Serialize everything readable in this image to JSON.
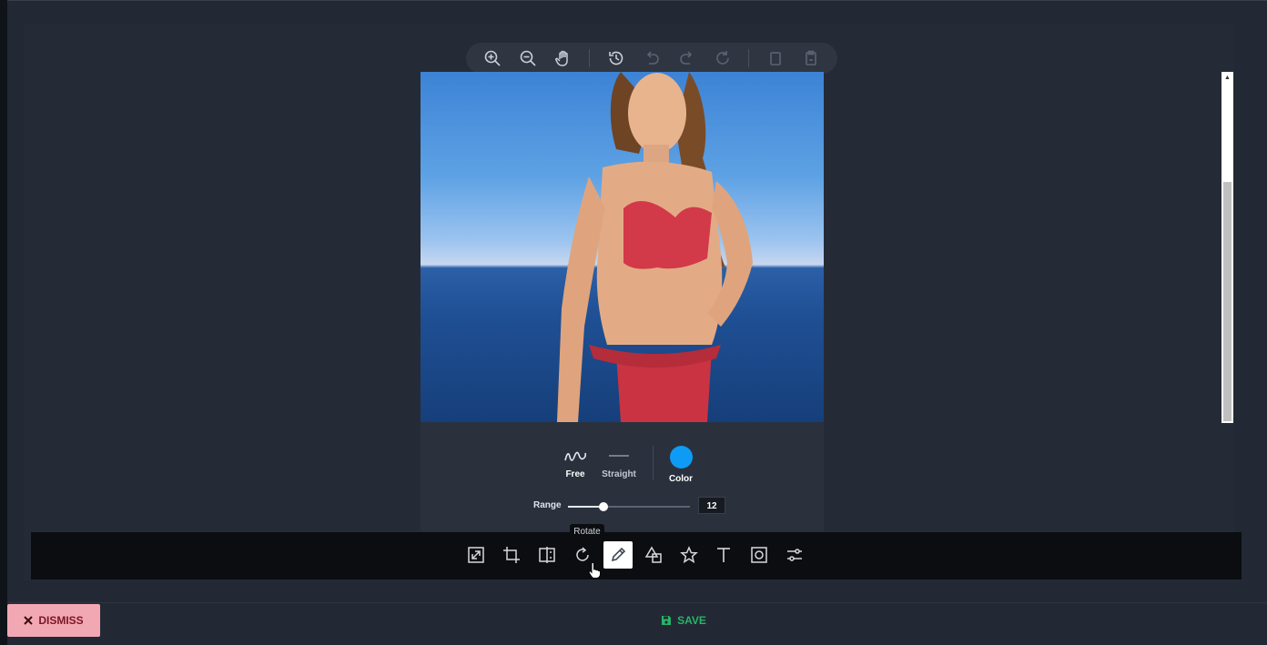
{
  "top_toolbar": {
    "icons": [
      "zoom-in-icon",
      "zoom-out-icon",
      "hand-icon",
      "history-icon",
      "undo-icon",
      "redo-icon",
      "reset-icon",
      "copy-icon",
      "paste-icon"
    ]
  },
  "draw_panel": {
    "stroke_free": "Free",
    "stroke_straight": "Straight",
    "color_label": "Color",
    "color_value": "#0d9bf5",
    "range_label": "Range",
    "range_value": "12",
    "range_fraction": 0.29
  },
  "bottom_toolbar": {
    "tools": [
      "resize",
      "crop",
      "flip",
      "rotate",
      "draw",
      "shape",
      "icon",
      "text",
      "mask",
      "filter"
    ],
    "active_tool": "draw",
    "tooltip": "Rotate"
  },
  "footer": {
    "dismiss_label": "DISMISS",
    "save_label": "SAVE"
  },
  "colors": {
    "accent_save": "#27b46a",
    "dismiss_bg": "#f2a8b3",
    "dismiss_text": "#7a1624"
  }
}
